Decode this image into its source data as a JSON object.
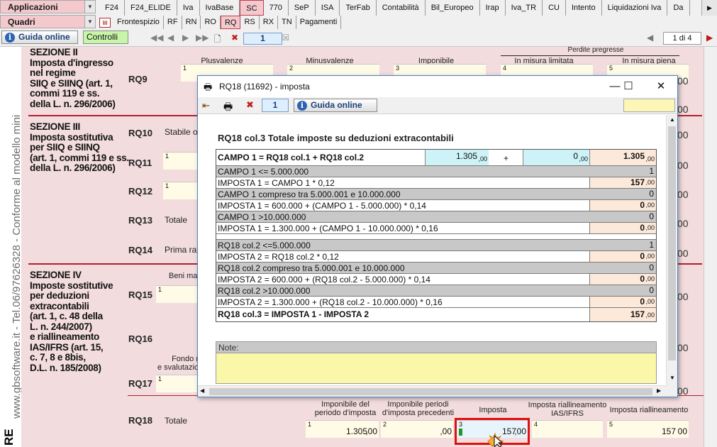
{
  "top": {
    "applicazioni": "Applicazioni",
    "quadri": "Quadri",
    "tabs": [
      "F24",
      "F24_ELIDE",
      "Iva",
      "IvaBase",
      "SC",
      "770",
      "SeP",
      "ISA",
      "TerFab",
      "Contabilità",
      "Bil_Europeo",
      "Irap",
      "Iva_TR",
      "CU",
      "Intento",
      "Liquidazioni Iva",
      "Da"
    ],
    "active_tab": "SC",
    "subtabs": [
      "Frontespizio",
      "RF",
      "RN",
      "RO",
      "RQ",
      "RS",
      "RX",
      "TN",
      "Pagamenti"
    ],
    "active_subtab": "RQ",
    "guida_online": "Guida online",
    "controlli": "Controlli",
    "page_number": "1",
    "page_count": "1 di 4"
  },
  "side": {
    "vertical_text": "www.gbsoftware.it - Tel.06/97626328 - Conforme al modello mini",
    "bottom_text": "RE"
  },
  "form": {
    "sec2": "SEZIONE II\nImposta d'ingresso\nnel regime\nSIIQ e SIINQ (art. 1,\ncommi 119 e ss.\ndella L. n. 296/2006)",
    "sec3": "SEZIONE III\nImposta sostitutiva\nper SIIQ e SIINQ\n(art. 1, commi 119 e ss.\ndella L. n. 296/2006)",
    "sec4": "SEZIONE IV\nImposte sostitutive\nper deduzioni\nextracontabili\n(art. 1, c. 48 della\nL. n. 244/2007)\ne riallineamento\nIAS/IFRS (art. 15,\nc. 7, 8 e 8bis,\nD.L. n. 185/2008)",
    "rq9_heads": [
      "Plusvalenze",
      "Minusvalenze",
      "Imponibile",
      "Perdite pregresse",
      "In misura limitata",
      "In misura piena"
    ],
    "rows": {
      "rq9": "RQ9",
      "rq10": "RQ10",
      "rq11": "RQ11",
      "rq12": "RQ12",
      "rq13": "RQ13",
      "rq14": "RQ14",
      "rq15": "RQ15",
      "rq16": "RQ16",
      "rq17": "RQ17",
      "rq18": "RQ18"
    },
    "rq10_text": "Stabile or",
    "rq13_text": "Totale",
    "rq14_text": "Prima rat",
    "rq15_head": "Beni mat",
    "rq17_head": "Fondo r\ne svalutazio",
    "rq18_text": "Totale",
    "rq18_heads": [
      "Imponibile del\nperiodo d'imposta",
      "Imponibile periodi\nd'imposta precedenti",
      "Imposta",
      "Imposta riallineamento\nIAS/IFRS",
      "Imposta riallineamento"
    ],
    "rq18_values": [
      "1.305",
      "",
      "157",
      "",
      "157"
    ],
    "dec": ",00",
    "side_zero": "00"
  },
  "dialog": {
    "title": "RQ18 (11692) -  imposta",
    "page": "1",
    "guida_online": "Guida online",
    "heading": "RQ18 col.3 Totale imposte su deduzioni extracontabili",
    "campo1_label": "CAMPO 1 = RQ18 col.1 + RQ18 col.2",
    "campo1_a": "1.305",
    "plus": "+",
    "campo1_b": "0",
    "campo1_total": "1.305",
    "dec": ",00",
    "rows": [
      {
        "label": "CAMPO 1 <= 5.000.000",
        "kind": "flag",
        "value": "1"
      },
      {
        "label": "IMPOSTA 1 = CAMPO 1 * 0,12",
        "kind": "amount",
        "value": "157"
      },
      {
        "label": "CAMPO 1 compreso tra 5.000.001 e 10.000.000",
        "kind": "flag",
        "value": "0"
      },
      {
        "label": "IMPOSTA 1 = 600.000 + (CAMPO 1 - 5.000.000) * 0,14",
        "kind": "amount",
        "value": "0"
      },
      {
        "label": "CAMPO 1 >10.000.000",
        "kind": "flag",
        "value": "0"
      },
      {
        "label": "IMPOSTA 1 = 1.300.000 + (CAMPO 1 - 10.000.000) * 0,16",
        "kind": "amount",
        "value": "0"
      },
      {
        "label": "",
        "kind": "spacer",
        "value": ""
      },
      {
        "label": "RQ18 col.2 <=5.000.000",
        "kind": "flag",
        "value": "1"
      },
      {
        "label": "IMPOSTA 2 = RQ18 col.2 * 0,12",
        "kind": "amount",
        "value": "0"
      },
      {
        "label": "RQ18 col.2 compreso tra 5.000.001 e 10.000.000",
        "kind": "flag",
        "value": "0"
      },
      {
        "label": "IMPOSTA 2 = 600.000 + (RQ18 col.2 - 5.000.000) * 0,14",
        "kind": "amount",
        "value": "0"
      },
      {
        "label": "RQ18 col.2 >10.000.000",
        "kind": "flag",
        "value": "0"
      },
      {
        "label": "IMPOSTA 2 = 1.300.000 + (RQ18 col.2 - 10.000.000) * 0,16",
        "kind": "amount",
        "value": "0"
      },
      {
        "label": "RQ18 col.3 = IMPOSTA 1 - IMPOSTA 2",
        "kind": "total",
        "value": "157"
      }
    ],
    "notes_label": "Note:"
  },
  "colors": {
    "form_bg": "#f2dcdd",
    "accent_red": "#b02030",
    "highlight_box": "#e01010",
    "input_cyan": "#cdf2f7",
    "calc_cell": "#fde9d9",
    "notes_bg": "#fbf7a8"
  }
}
